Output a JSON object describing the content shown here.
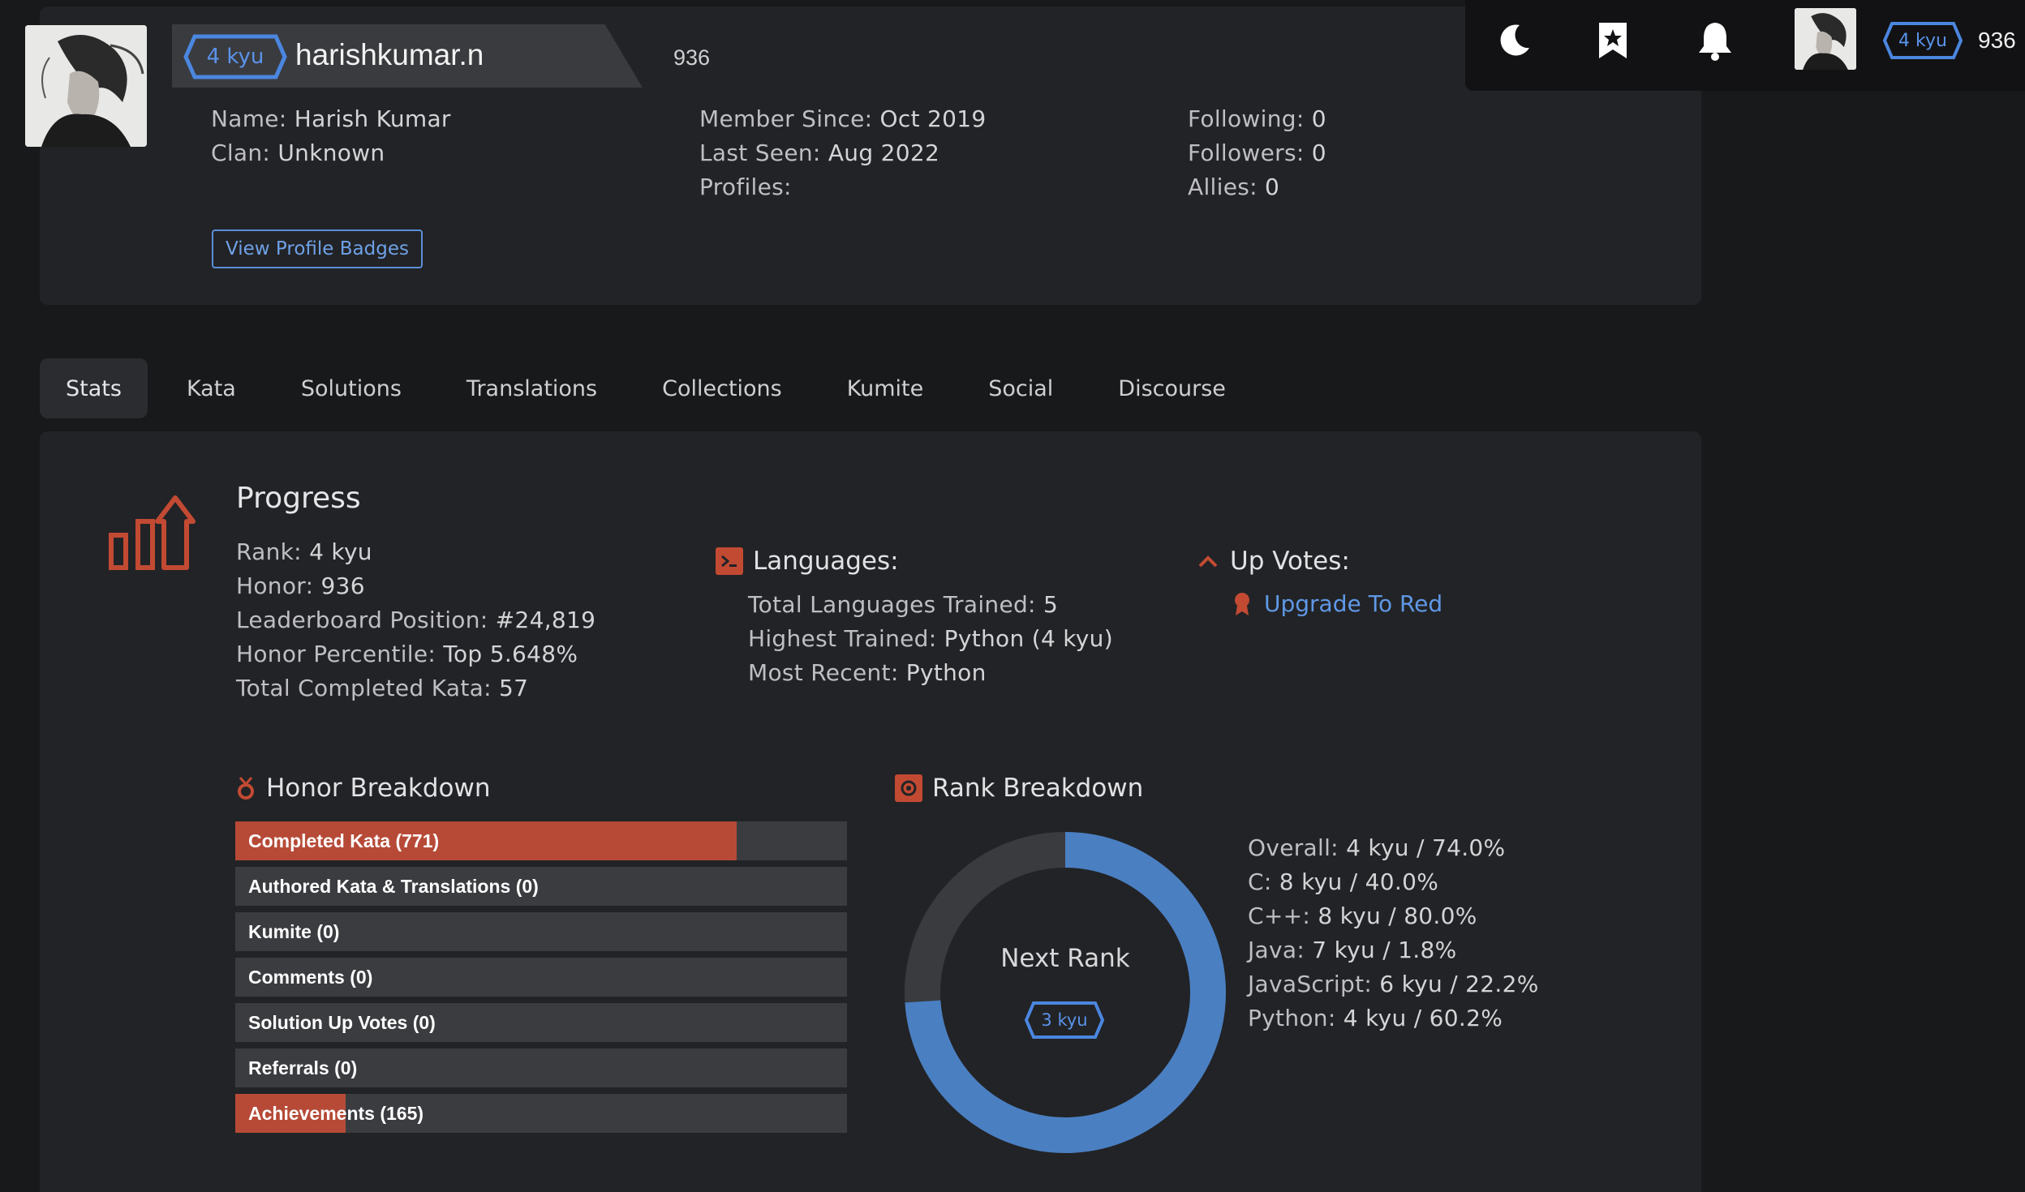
{
  "profile": {
    "rank_badge": "4 kyu",
    "username": "harishkumar.n",
    "honor": "936",
    "name_label": "Name:",
    "name_value": "Harish Kumar",
    "clan_label": "Clan:",
    "clan_value": "Unknown",
    "member_since_label": "Member Since:",
    "member_since_value": "Oct 2019",
    "last_seen_label": "Last Seen:",
    "last_seen_value": "Aug 2022",
    "profiles_label": "Profiles:",
    "following_label": "Following:",
    "following_value": "0",
    "followers_label": "Followers:",
    "followers_value": "0",
    "allies_label": "Allies:",
    "allies_value": "0",
    "view_badges_label": "View Profile Badges"
  },
  "topbar": {
    "icons": [
      "moon-icon",
      "bookmark-star-icon",
      "bell-icon"
    ],
    "rank_badge": "4 kyu",
    "honor": "936"
  },
  "tabs": [
    "Stats",
    "Kata",
    "Solutions",
    "Translations",
    "Collections",
    "Kumite",
    "Social",
    "Discourse"
  ],
  "active_tab": "Stats",
  "progress": {
    "title": "Progress",
    "rank_label": "Rank:",
    "rank_value": "4 kyu",
    "honor_label": "Honor:",
    "honor_value": "936",
    "leaderboard_label": "Leaderboard Position:",
    "leaderboard_value": "#24,819",
    "percentile_label": "Honor Percentile:",
    "percentile_value": "Top 5.648%",
    "completed_label": "Total Completed Kata:",
    "completed_value": "57"
  },
  "languages": {
    "title": "Languages:",
    "total_label": "Total Languages Trained:",
    "total_value": "5",
    "highest_label": "Highest Trained:",
    "highest_value": "Python (4 kyu)",
    "recent_label": "Most Recent:",
    "recent_value": "Python"
  },
  "upvotes": {
    "title": "Up Votes:",
    "link": "Upgrade To Red"
  },
  "honor_breakdown": {
    "title": "Honor Breakdown",
    "items": [
      {
        "label": "Completed Kata (771)",
        "fill": 0.82
      },
      {
        "label": "Authored Kata & Translations (0)",
        "fill": 0
      },
      {
        "label": "Kumite (0)",
        "fill": 0
      },
      {
        "label": "Comments (0)",
        "fill": 0
      },
      {
        "label": "Solution Up Votes (0)",
        "fill": 0
      },
      {
        "label": "Referrals (0)",
        "fill": 0
      },
      {
        "label": "Achievements (165)",
        "fill": 0.18
      }
    ]
  },
  "rank_breakdown": {
    "title": "Rank Breakdown",
    "next_rank_label": "Next Rank",
    "next_rank_badge": "3 kyu",
    "progress": 0.74,
    "colors": {
      "filled": "#4a7fc2",
      "empty": "#3a3b3f"
    },
    "rows": [
      {
        "label": "Overall:",
        "value": "4 kyu / 74.0%"
      },
      {
        "label": "C:",
        "value": "8 kyu / 40.0%"
      },
      {
        "label": "C++:",
        "value": "8 kyu / 80.0%"
      },
      {
        "label": "Java:",
        "value": "7 kyu / 1.8%"
      },
      {
        "label": "JavaScript:",
        "value": "6 kyu / 22.2%"
      },
      {
        "label": "Python:",
        "value": "4 kyu / 60.2%"
      }
    ]
  }
}
